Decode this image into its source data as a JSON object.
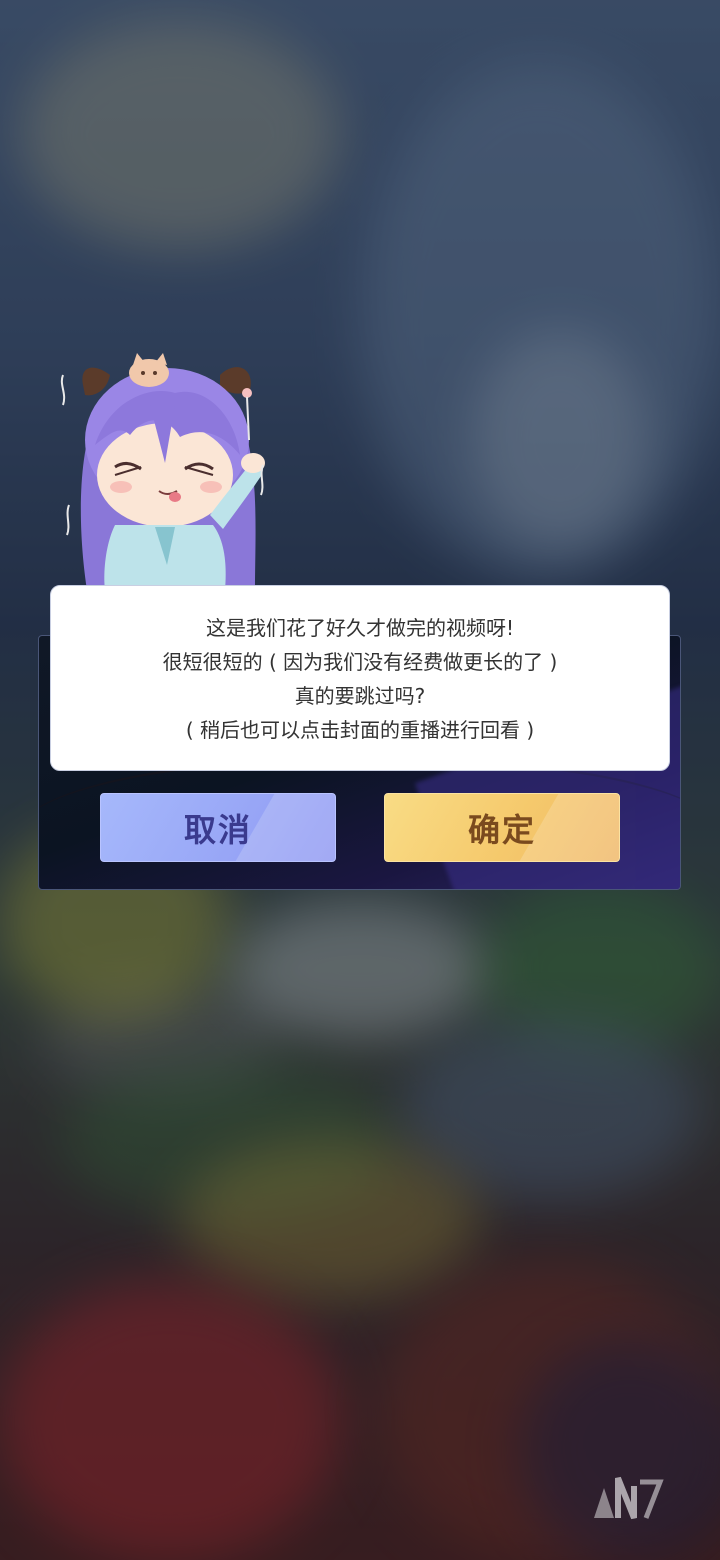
{
  "dialog": {
    "message_lines": [
      "这是我们花了好久才做完的视频呀!",
      "很短很短的 ( 因为我们没有经费做更长的了 )",
      "真的要跳过吗?",
      "( 稍后也可以点击封面的重播进行回看 )"
    ],
    "cancel_label": "取消",
    "confirm_label": "确定"
  },
  "colors": {
    "cancel_button": "#9aa9f7",
    "confirm_button": "#f5c96c",
    "message_text": "#333333"
  },
  "icons": {
    "mascot": "chibi-character-purple-hair",
    "corner_logo": "watermark-logo"
  }
}
